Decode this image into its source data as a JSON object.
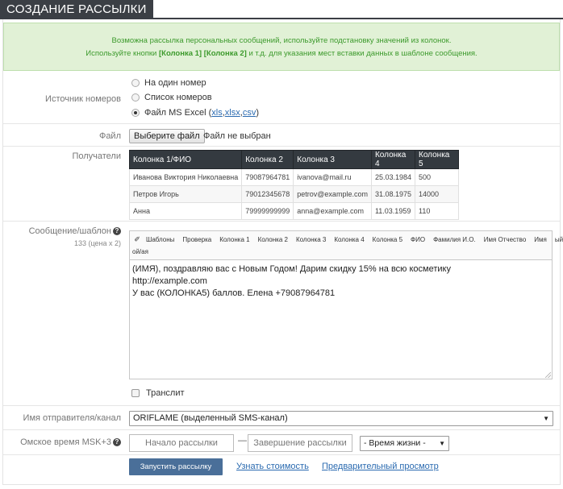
{
  "page": {
    "title": "СОЗДАНИЕ РАССЫЛКИ"
  },
  "info": {
    "line1": "Возможна рассылка персональных сообщений, используйте подстановку значений из колонок.",
    "line2_prefix": "Используйте кнопки ",
    "line2_buttons": "[Колонка 1] [Колонка 2]",
    "line2_suffix": " и т.д. для указания мест вставки данных в шаблоне сообщения."
  },
  "source": {
    "label": "Источник номеров",
    "options": [
      {
        "label": "На один номер",
        "selected": false
      },
      {
        "label": "Список номеров",
        "selected": false
      },
      {
        "label": "Файл MS Excel (",
        "selected": true
      }
    ],
    "formats": [
      "xls",
      "xlsx",
      "csv"
    ],
    "format_sep": ",",
    "format_close": ")"
  },
  "file": {
    "label": "Файл",
    "button": "Выберите файл",
    "status": "Файл не выбран"
  },
  "recipients": {
    "label": "Получатели",
    "columns": [
      "Колонка 1/ФИО",
      "Колонка 2",
      "Колонка 3",
      "Колонка 4",
      "Колонка 5"
    ],
    "rows": [
      [
        "Иванова Виктория Николаевна",
        "79087964781",
        "ivanova@mail.ru",
        "25.03.1984",
        "500"
      ],
      [
        "Петров Игорь",
        "79012345678",
        "petrov@example.com",
        "31.08.1975",
        "14000"
      ],
      [
        "Анна",
        "79999999999",
        "anna@example.com",
        "11.03.1959",
        "110"
      ]
    ]
  },
  "message": {
    "label": "Сообщение/шаблон",
    "sublabel": "133 (цена x 2)",
    "toolbar": [
      "Шаблоны",
      "Проверка",
      "Колонка 1",
      "Колонка 2",
      "Колонка 3",
      "Колонка 4",
      "Колонка 5",
      "ФИО",
      "Фамилия И.О.",
      "Имя Отчество",
      "Имя",
      "ый/ая"
    ],
    "toolbar_line2": "ой/ая",
    "text_lines": [
      "(ИМЯ), поздравляю вас с Новым Годом! Дарим скидку 15% на всю косметику",
      "http://example.com",
      "У вас (КОЛОНКА5) баллов. Елена +79087964781"
    ],
    "translit": "Транслит"
  },
  "sender": {
    "label": "Имя отправителя/канал",
    "value": "ORIFLAME (выделенный SMS-канал)"
  },
  "schedule": {
    "label": "Омское время MSK+3",
    "start_placeholder": "Начало рассылки",
    "end_placeholder": "Завершение рассылки",
    "dash": "—",
    "lifetime": "- Время жизни -"
  },
  "actions": {
    "submit": "Запустить рассылку",
    "cost_link": "Узнать стоимость",
    "preview_link": "Предварительный просмотр"
  }
}
